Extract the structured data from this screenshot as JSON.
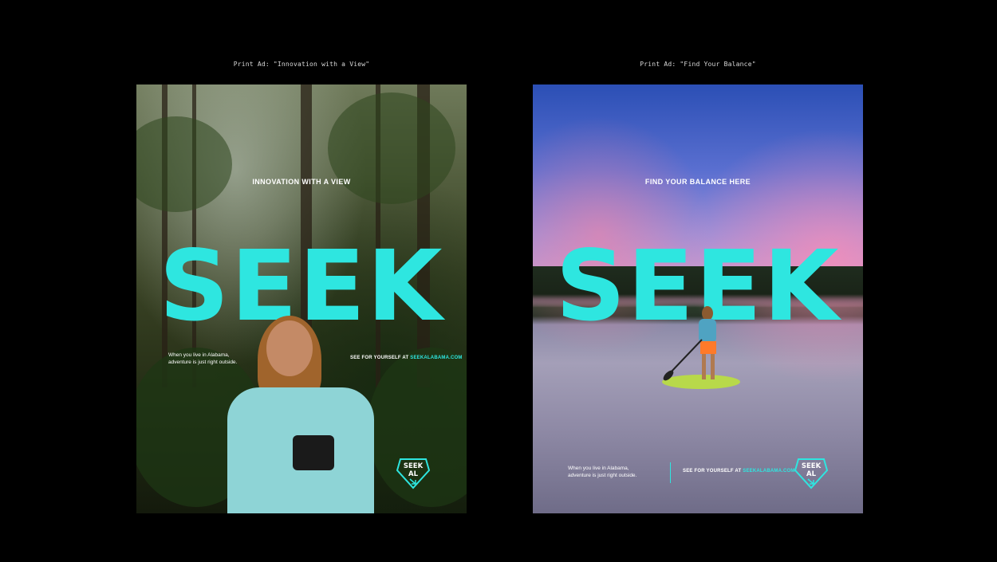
{
  "ads": [
    {
      "caption": "Print Ad: \"Innovation with a View\"",
      "headline": "INNOVATION WITH A VIEW",
      "brand": "SEEK",
      "tagline_line1": "When you live in Alabama,",
      "tagline_line2": "adventure is just right outside.",
      "cta_prefix": "SEE FOR YOURSELF AT",
      "cta_url": "SEEKALABAMA.COM",
      "logo_line1": "SEEK",
      "logo_line2": "AL"
    },
    {
      "caption": "Print Ad: \"Find Your Balance\"",
      "headline": "FIND YOUR BALANCE HERE",
      "brand": "SEEK",
      "tagline_line1": "When you live in Alabama,",
      "tagline_line2": "adventure is just right outside.",
      "cta_prefix": "SEE FOR YOURSELF AT",
      "cta_url": "SEEKALABAMA.COM",
      "logo_line1": "SEEK",
      "logo_line2": "AL"
    }
  ],
  "colors": {
    "background": "#000000",
    "accent": "#2ee6e0"
  },
  "icons": [
    "seek-al-logo-icon",
    "arrow-down-right-icon"
  ]
}
